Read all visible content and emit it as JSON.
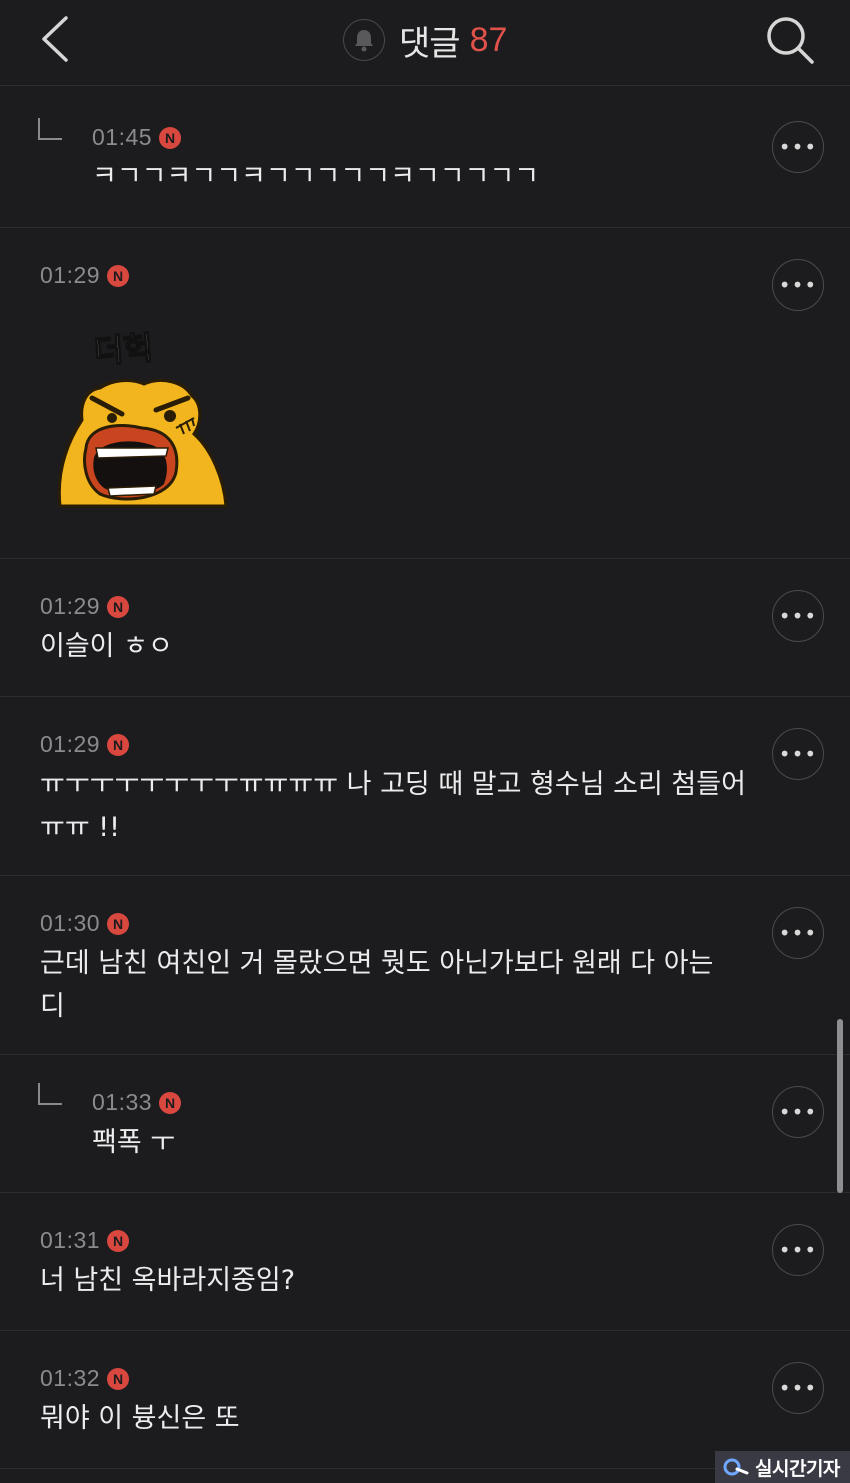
{
  "header": {
    "title": "댓글",
    "count": "87"
  },
  "comments": [
    {
      "time": "01:45",
      "badge": "N",
      "text": "ㅋㄱㄱㅋㄱㄱㅋㄱㄱㄱㄱㄱㅋㄱㄱㄱㄱㄱ",
      "reply": true
    },
    {
      "time": "01:29",
      "badge": "N",
      "text": "",
      "reply": false,
      "sticker_text": "더헉"
    },
    {
      "time": "01:29",
      "badge": "N",
      "text": "이슬이 ㅎㅇ",
      "reply": false
    },
    {
      "time": "01:29",
      "badge": "N",
      "text": "ㅠㅜㅜㅜㅜㅜㅜㅜㅠㅠㅠㅠ 나 고딩 때 말고 형수님 소리 첨들어\nㅠㅠ !!",
      "reply": false
    },
    {
      "time": "01:30",
      "badge": "N",
      "text": "근데 남친 여친인 거 몰랐으면 뭣도 아닌가보다 원래 다 아는\n디",
      "reply": false
    },
    {
      "time": "01:33",
      "badge": "N",
      "text": "팩폭 ㅜ",
      "reply": true
    },
    {
      "time": "01:31",
      "badge": "N",
      "text": "너 남친 옥바라지중임?",
      "reply": false
    },
    {
      "time": "01:32",
      "badge": "N",
      "text": "뭐야 이 븅신은 또",
      "reply": false
    }
  ],
  "more_label": "•••",
  "watermark": {
    "text": "실시간기자"
  },
  "colors": {
    "background": "#1c1c1e",
    "accent": "#e0524a",
    "badge": "#d9483f",
    "time": "#8b8b8e"
  },
  "icons": [
    "back-icon",
    "bell-icon",
    "search-icon",
    "more-icon",
    "reply-arrow-icon"
  ]
}
